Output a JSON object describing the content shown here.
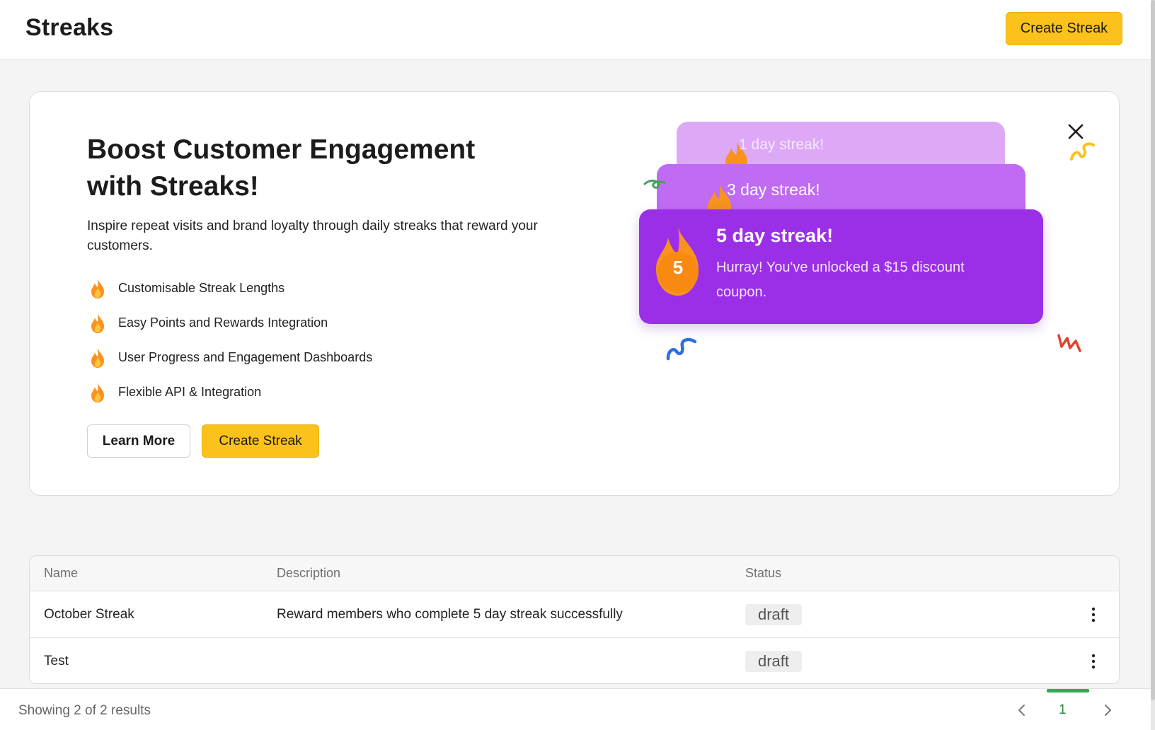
{
  "header": {
    "title": "Streaks",
    "create_button": "Create Streak"
  },
  "banner": {
    "headline_line1": "Boost Customer Engagement",
    "headline_line2": "with Streaks!",
    "subtitle": "Inspire repeat visits and brand loyalty through daily streaks that reward your customers.",
    "features": [
      "Customisable Streak Lengths",
      "Easy Points and Rewards Integration",
      "User Progress and Engagement Dashboards",
      "Flexible API & Integration"
    ],
    "learn_more_button": "Learn More",
    "create_button": "Create Streak",
    "illustration": {
      "card1": "1 day streak!",
      "card2": "3 day streak!",
      "card3_title": "5 day streak!",
      "card3_message": "Hurray! You've unlocked a $15 discount coupon.",
      "badge_number": "5"
    }
  },
  "table": {
    "columns": [
      "Name",
      "Description",
      "Status"
    ],
    "rows": [
      {
        "name": "October Streak",
        "description": "Reward members who complete 5 day streak successfully",
        "status": "draft"
      },
      {
        "name": "Test",
        "description": "",
        "status": "draft"
      }
    ]
  },
  "footer": {
    "summary": "Showing 2 of 2 results",
    "current_page": "1"
  },
  "colors": {
    "accent_yellow": "#fbc21b",
    "purple_dark": "#9b2fe8",
    "purple_mid": "#bf6bf3",
    "purple_light": "#dda9f7",
    "flame_orange": "#f7931e",
    "pagination_green": "#2e8b44"
  },
  "icons": {
    "feature_bullet": "flame-icon",
    "close": "close-icon",
    "row_menu": "kebab-menu-icon",
    "prev": "chevron-left-icon",
    "next": "chevron-right-icon"
  }
}
